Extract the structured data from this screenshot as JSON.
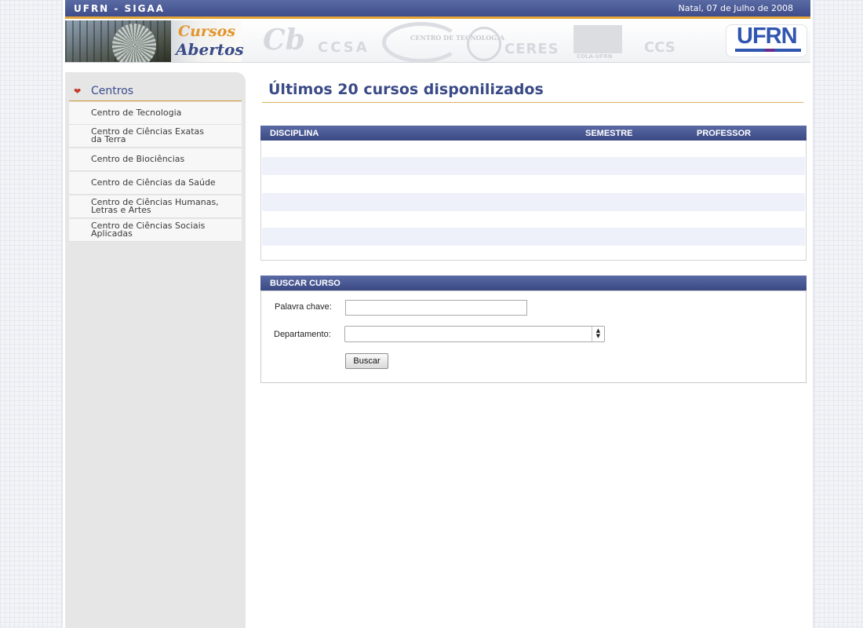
{
  "header": {
    "system_title": "UFRN - SIGAA",
    "date": "Natal, 07 de Julho de 2008"
  },
  "banner": {
    "title_line1": "Cursos",
    "title_line2": "Abertos",
    "center_logos": [
      "Cb",
      "CCSA",
      "CENTRO DE TECNOLOGIA",
      "CERES",
      "COLA-UFRN",
      "CCS"
    ],
    "university_logo": "UFRN"
  },
  "sidebar": {
    "heading": "Centros",
    "items": [
      {
        "label": "Centro de Tecnologia"
      },
      {
        "label": "Centro de Ciências Exatas da Terra"
      },
      {
        "label": "Centro de Biociências"
      },
      {
        "label": "Centro de Ciências da Saúde"
      },
      {
        "label": "Centro de Ciências Humanas, Letras e Artes"
      },
      {
        "label": "Centro de Ciências Sociais Aplicadas"
      }
    ]
  },
  "main": {
    "title": "Últimos 20 cursos disponilizados",
    "table": {
      "columns": [
        "DISCIPLINA",
        "SEMESTRE",
        "PROFESSOR"
      ],
      "rows": []
    },
    "search": {
      "header": "BUSCAR CURSO",
      "keyword_label": "Palavra chave:",
      "keyword_value": "",
      "department_label": "Departamento:",
      "department_value": "",
      "submit_label": "Buscar"
    }
  },
  "colors": {
    "header_blue": "#3e4d8a",
    "accent_orange": "#e4a43a",
    "title_blue": "#3a4a86",
    "row_alt": "#eef1f9"
  }
}
